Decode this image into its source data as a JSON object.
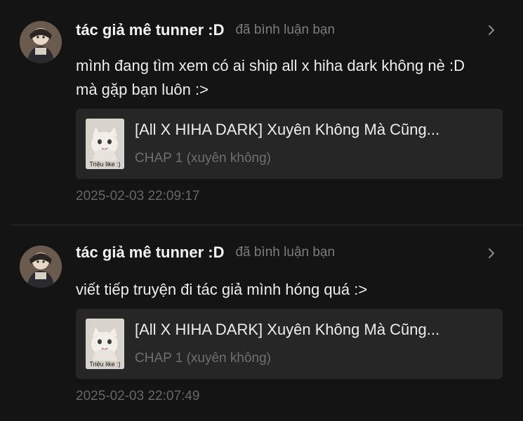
{
  "notifications": [
    {
      "username": "tác giả mê tunner :D",
      "action": "đã bình luận bạn",
      "comment": "mình đang tìm xem có ai ship all x hiha dark không nè :D mà gặp bạn luôn :>",
      "story": {
        "title": "[All X HIHA DARK] Xuyên Không Mà Cũng...",
        "chapter": "CHAP 1 (xuyên không)",
        "cover_caption": "Triệu like :)"
      },
      "timestamp": "2025-02-03 22:09:17"
    },
    {
      "username": "tác giả mê tunner :D",
      "action": "đã bình luận bạn",
      "comment": "viết tiếp truyện đi tác giả mình hóng quá :>",
      "story": {
        "title": "[All X HIHA DARK] Xuyên Không Mà Cũng...",
        "chapter": "CHAP 1 (xuyên không)",
        "cover_caption": "Triệu like :)"
      },
      "timestamp": "2025-02-03 22:07:49"
    }
  ],
  "icons": {
    "avatar": "user-avatar",
    "chevron": "chevron-right-icon",
    "cover": "story-cover-thumbnail"
  },
  "colors": {
    "background": "#141414",
    "card": "#262626",
    "username": "#f2f2f2",
    "muted": "#7c7c7c"
  }
}
